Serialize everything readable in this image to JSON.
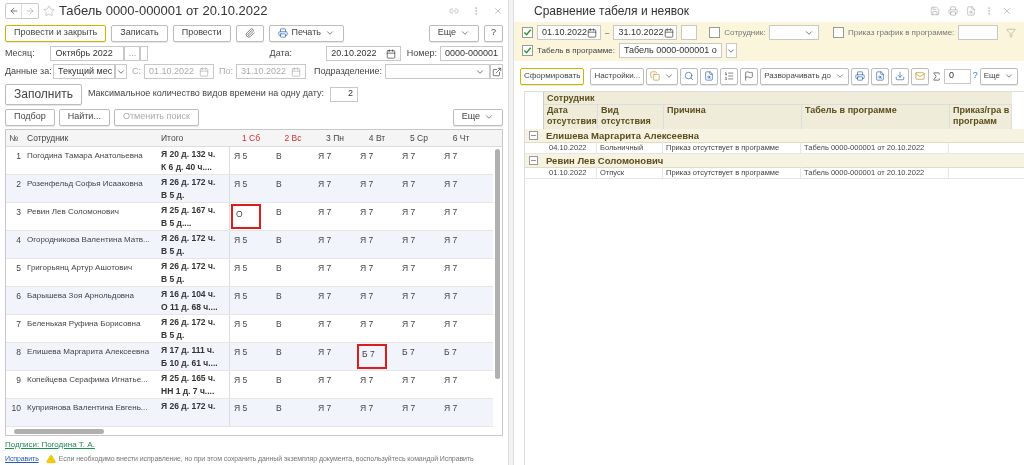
{
  "left": {
    "title": "Табель 0000-000001 от 20.10.2022",
    "toolbar": {
      "post_close": "Провести и закрыть",
      "save": "Записать",
      "post": "Провести",
      "print": "Печать",
      "more": "Еще",
      "help": "?"
    },
    "month": {
      "label": "Месяц:",
      "value": "Октябрь 2022",
      "picker": "..."
    },
    "date": {
      "label": "Дата:",
      "value": "20.10.2022"
    },
    "number": {
      "label": "Номер:",
      "value": "0000-000001"
    },
    "data_for": {
      "label": "Данные за:",
      "value": "Текущий мес"
    },
    "from": {
      "label": "С:",
      "value": "01.10.2022",
      "disabled": true
    },
    "to": {
      "label": "По:",
      "value": "31.10.2022",
      "disabled": true
    },
    "department": {
      "label": "Подразделение:"
    },
    "fill_button": "Заполнить",
    "max_types": {
      "label": "Максимальное количество видов времени на одну дату:",
      "value": "2"
    },
    "table_toolbar": {
      "pick": "Подбор",
      "find": "Найти...",
      "cancel_search": {
        "label": "Отменить поиск",
        "disabled": true
      },
      "more": "Еще"
    },
    "table": {
      "columns": [
        "№",
        "Сотрудник",
        "Итого"
      ],
      "days": [
        {
          "label": "1 Сб",
          "weekend": true
        },
        {
          "label": "2 Вс",
          "weekend": true
        },
        {
          "label": "3 Пн",
          "weekend": false
        },
        {
          "label": "4 Вт",
          "weekend": false
        },
        {
          "label": "5 Ср",
          "weekend": false
        },
        {
          "label": "6 Чт",
          "weekend": false
        }
      ],
      "rows": [
        {
          "num": "1",
          "name": "Погодина Тамара Анатольевна",
          "total": [
            "Я 20 д. 132 ч.",
            "К 6 д. 40 ч...."
          ],
          "days": [
            {
              "text": "Я 5",
              "highlighted": false
            },
            {
              "text": "В",
              "highlighted": false
            },
            {
              "text": "Я 7",
              "highlighted": false
            },
            {
              "text": "Я 7",
              "highlighted": false
            },
            {
              "text": "Я 7",
              "highlighted": false
            },
            {
              "text": "Я 7",
              "highlighted": false
            }
          ]
        },
        {
          "num": "2",
          "name": "Розенфельд Софья Исааковна",
          "total": [
            "Я 26 д. 172 ч.",
            "В 5 д."
          ],
          "days": [
            {
              "text": "Я 5",
              "highlighted": false
            },
            {
              "text": "В",
              "highlighted": false
            },
            {
              "text": "Я 7",
              "highlighted": false
            },
            {
              "text": "Я 7",
              "highlighted": false
            },
            {
              "text": "Я 7",
              "highlighted": false
            },
            {
              "text": "Я 7",
              "highlighted": false
            }
          ]
        },
        {
          "num": "3",
          "name": "Ревин Лев Соломонович",
          "total": [
            "Я 25 д. 167 ч.",
            "В 5 д...."
          ],
          "days": [
            {
              "text": "О",
              "highlighted": true
            },
            {
              "text": "В",
              "highlighted": false
            },
            {
              "text": "Я 7",
              "highlighted": false
            },
            {
              "text": "Я 7",
              "highlighted": false
            },
            {
              "text": "Я 7",
              "highlighted": false
            },
            {
              "text": "Я 7",
              "highlighted": false
            }
          ]
        },
        {
          "num": "4",
          "name": "Огородникова Валентина Матв...",
          "total": [
            "Я 26 д. 172 ч.",
            "В 5 д."
          ],
          "days": [
            {
              "text": "Я 5",
              "highlighted": false
            },
            {
              "text": "В",
              "highlighted": false
            },
            {
              "text": "Я 7",
              "highlighted": false
            },
            {
              "text": "Я 7",
              "highlighted": false
            },
            {
              "text": "Я 7",
              "highlighted": false
            },
            {
              "text": "Я 7",
              "highlighted": false
            }
          ]
        },
        {
          "num": "5",
          "name": "Григорьянц Артур Ашотович",
          "total": [
            "Я 26 д. 172 ч.",
            "В 5 д."
          ],
          "days": [
            {
              "text": "Я 5",
              "highlighted": false
            },
            {
              "text": "В",
              "highlighted": false
            },
            {
              "text": "Я 7",
              "highlighted": false
            },
            {
              "text": "Я 7",
              "highlighted": false
            },
            {
              "text": "Я 7",
              "highlighted": false
            },
            {
              "text": "Я 7",
              "highlighted": false
            }
          ]
        },
        {
          "num": "6",
          "name": "Барышева Зоя Арнольдовна",
          "total": [
            "Я 16 д. 104 ч.",
            "О 11 д. 68 ч...."
          ],
          "days": [
            {
              "text": "Я 5",
              "highlighted": false
            },
            {
              "text": "В",
              "highlighted": false
            },
            {
              "text": "Я 7",
              "highlighted": false
            },
            {
              "text": "Я 7",
              "highlighted": false
            },
            {
              "text": "Я 7",
              "highlighted": false
            },
            {
              "text": "Я 7",
              "highlighted": false
            }
          ]
        },
        {
          "num": "7",
          "name": "Беленькая Руфина Борисовна",
          "total": [
            "Я 26 д. 172 ч.",
            "В 5 д."
          ],
          "days": [
            {
              "text": "Я 5",
              "highlighted": false
            },
            {
              "text": "В",
              "highlighted": false
            },
            {
              "text": "Я 7",
              "highlighted": false
            },
            {
              "text": "Я 7",
              "highlighted": false
            },
            {
              "text": "Я 7",
              "highlighted": false
            },
            {
              "text": "Я 7",
              "highlighted": false
            }
          ]
        },
        {
          "num": "8",
          "name": "Елишева Маргарита Алексеевна",
          "total": [
            "Я 17 д. 111 ч.",
            "Б 10 д. 61 ч...."
          ],
          "days": [
            {
              "text": "Я 5",
              "highlighted": false
            },
            {
              "text": "В",
              "highlighted": false
            },
            {
              "text": "Я 7",
              "highlighted": false
            },
            {
              "text": "Б 7",
              "highlighted": true
            },
            {
              "text": "Б 7",
              "highlighted": false
            },
            {
              "text": "Б 7",
              "highlighted": false
            }
          ]
        },
        {
          "num": "9",
          "name": "Копейцева Серафима Игнатье...",
          "total": [
            "Я 25 д. 165 ч.",
            "НН 1 д. 7 ч...."
          ],
          "days": [
            {
              "text": "Я 5",
              "highlighted": false
            },
            {
              "text": "В",
              "highlighted": false
            },
            {
              "text": "Я 7",
              "highlighted": false
            },
            {
              "text": "Я 7",
              "highlighted": false
            },
            {
              "text": "Я 7",
              "highlighted": false
            },
            {
              "text": "Я 7",
              "highlighted": false
            }
          ]
        },
        {
          "num": "10",
          "name": "Куприянова Валентина Евгень...",
          "total": [
            "Я 26 д. 172 ч."
          ],
          "days": [
            {
              "text": "Я 5",
              "highlighted": false
            },
            {
              "text": "В",
              "highlighted": false
            },
            {
              "text": "Я 7",
              "highlighted": false
            },
            {
              "text": "Я 7",
              "highlighted": false
            },
            {
              "text": "Я 7",
              "highlighted": false
            },
            {
              "text": "Я 7",
              "highlighted": false
            }
          ]
        }
      ]
    },
    "signatures": "Подписи: Погодина Т. А.",
    "fix_link": "Исправить",
    "warning": "Если необходимо внести исправление, но при этом сохранить данный экземпляр документа, воспользуйтесь командой Исправить"
  },
  "right": {
    "title": "Сравнение табеля и неявок",
    "filters": {
      "period": {
        "checked": true,
        "from": "01.10.2022",
        "dash": "–",
        "to": "31.10.2022"
      },
      "employee": {
        "label": "Сотрудник:",
        "checked": false
      },
      "order": {
        "label": "Приказ график в программе:",
        "checked": false
      },
      "timesheet": {
        "label": "Табель в программе:",
        "checked": true,
        "value": "Табель 0000-000001 о"
      }
    },
    "toolbar": {
      "generate": "Сформировать",
      "settings": "Настройки...",
      "expand": "Разворачивать до",
      "sum": "0",
      "help": "?",
      "more": "Еще"
    },
    "report": {
      "group_header": "Сотрудник",
      "columns": [
        "Дата отсутствия",
        "Вид отсутствия",
        "Причина",
        "Табель в программе",
        "Приказ/гра в программ"
      ],
      "groups": [
        {
          "name": "Елишева Маргарита Алексеевна",
          "expanded": true,
          "rows": [
            {
              "date": "04.10.2022",
              "kind": "Больничный",
              "reason": "Приказ отсутствует в программе",
              "timesheet": "Табель 0000-000001 от 20.10.2022"
            }
          ]
        },
        {
          "name": "Ревин Лев Соломонович",
          "expanded": true,
          "rows": [
            {
              "date": "01.10.2022",
              "kind": "Отпуск",
              "reason": "Приказ отсутствует в программе",
              "timesheet": "Табель 0000-000001 от 20.10.2022"
            }
          ]
        }
      ]
    }
  }
}
